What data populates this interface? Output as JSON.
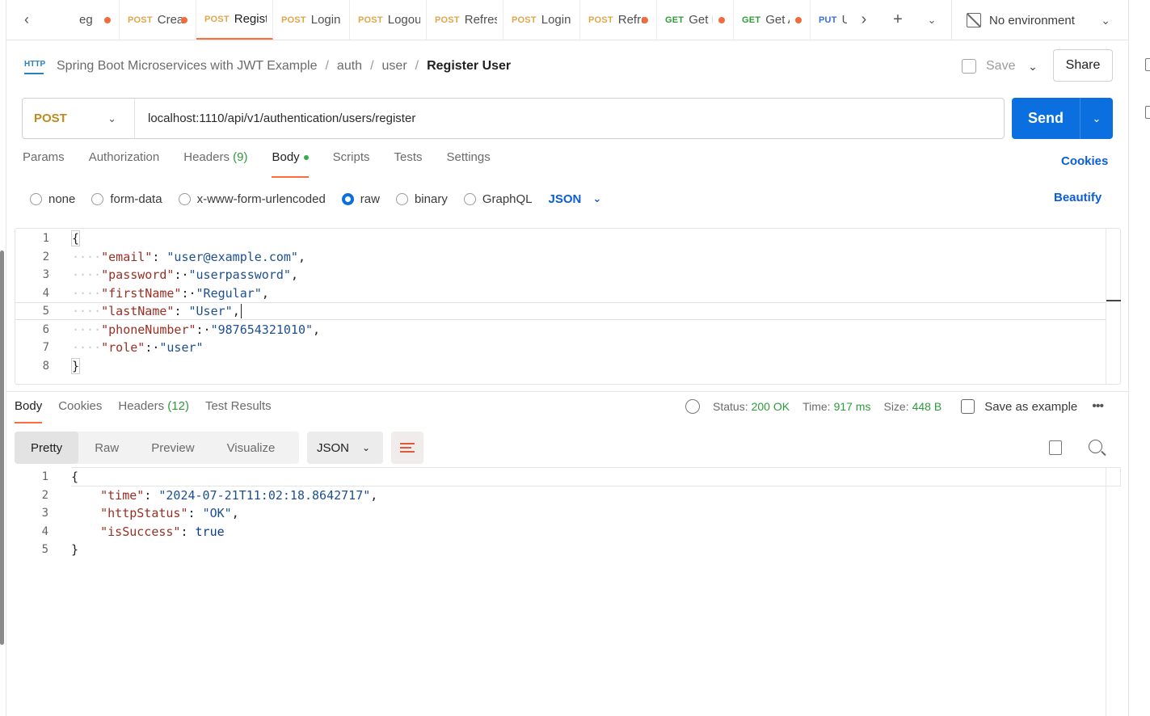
{
  "tabs": {
    "items": [
      {
        "method": "",
        "name": "eg",
        "dot": true,
        "active": false
      },
      {
        "method": "POST",
        "name": "Create",
        "dot": true,
        "active": false
      },
      {
        "method": "POST",
        "name": "Register",
        "dot": false,
        "active": true
      },
      {
        "method": "POST",
        "name": "Login",
        "dot": false,
        "active": false
      },
      {
        "method": "POST",
        "name": "Logout",
        "dot": false,
        "active": false
      },
      {
        "method": "POST",
        "name": "Refresh",
        "dot": false,
        "active": false
      },
      {
        "method": "POST",
        "name": "Login",
        "dot": false,
        "active": false
      },
      {
        "method": "POST",
        "name": "Refresh",
        "dot": true,
        "active": false
      },
      {
        "method": "GET",
        "name": "Get P",
        "dot": true,
        "active": false
      },
      {
        "method": "GET",
        "name": "Get A",
        "dot": true,
        "active": false
      },
      {
        "method": "PUT",
        "name": "Update",
        "dot": false,
        "active": false
      }
    ],
    "environment": "No environment"
  },
  "breadcrumb": {
    "collection": "Spring Boot Microservices with JWT Example",
    "folder1": "auth",
    "folder2": "user",
    "current": "Register User",
    "save_label": "Save",
    "share_label": "Share"
  },
  "request": {
    "method": "POST",
    "url": "localhost:1110/api/v1/authentication/users/register",
    "send_label": "Send",
    "tabs": {
      "params": "Params",
      "authorization": "Authorization",
      "headers": "Headers",
      "headers_count": "(9)",
      "body": "Body",
      "scripts": "Scripts",
      "tests": "Tests",
      "settings": "Settings"
    },
    "cookies_label": "Cookies",
    "body_types": [
      "none",
      "form-data",
      "x-www-form-urlencoded",
      "raw",
      "binary",
      "GraphQL"
    ],
    "selected_body_type": "raw",
    "format": "JSON",
    "beautify_label": "Beautify",
    "body_lines": [
      {
        "ln": "1",
        "indent": "",
        "key": "",
        "sep": "",
        "val": "",
        "text": "{"
      },
      {
        "ln": "2",
        "indent": "····",
        "key": "\"email\"",
        "sep": ": ",
        "val": "\"user@example.com\"",
        "text": ","
      },
      {
        "ln": "3",
        "indent": "····",
        "key": "\"password\"",
        "sep": ":·",
        "val": "\"userpassword\"",
        "text": ","
      },
      {
        "ln": "4",
        "indent": "····",
        "key": "\"firstName\"",
        "sep": ":·",
        "val": "\"Regular\"",
        "text": ","
      },
      {
        "ln": "5",
        "indent": "····",
        "key": "\"lastName\"",
        "sep": ": ",
        "val": "\"User\"",
        "text": ","
      },
      {
        "ln": "6",
        "indent": "····",
        "key": "\"phoneNumber\"",
        "sep": ":·",
        "val": "\"987654321010\"",
        "text": ","
      },
      {
        "ln": "7",
        "indent": "····",
        "key": "\"role\"",
        "sep": ":·",
        "val": "\"user\"",
        "text": ""
      },
      {
        "ln": "8",
        "indent": "",
        "key": "",
        "sep": "",
        "val": "",
        "text": "}"
      }
    ]
  },
  "response": {
    "tabs": {
      "body": "Body",
      "cookies": "Cookies",
      "headers": "Headers",
      "headers_count": "(12)",
      "test_results": "Test Results"
    },
    "status_label": "Status:",
    "status_value": "200 OK",
    "time_label": "Time:",
    "time_value": "917 ms",
    "size_label": "Size:",
    "size_value": "448 B",
    "save_example_label": "Save as example",
    "views": [
      "Pretty",
      "Raw",
      "Preview",
      "Visualize"
    ],
    "active_view": "Pretty",
    "format": "JSON",
    "body_lines": [
      {
        "ln": "1",
        "key": "",
        "sep": "",
        "val": "",
        "text": "{"
      },
      {
        "ln": "2",
        "key": "\"time\"",
        "sep": ": ",
        "val": "\"2024-07-21T11:02:18.8642717\"",
        "text": ","
      },
      {
        "ln": "3",
        "key": "\"httpStatus\"",
        "sep": ": ",
        "val": "\"OK\"",
        "text": ","
      },
      {
        "ln": "4",
        "key": "\"isSuccess\"",
        "sep": ": ",
        "val": "true",
        "text": ""
      },
      {
        "ln": "5",
        "key": "",
        "sep": "",
        "val": "",
        "text": "}"
      }
    ]
  },
  "colors": {
    "accent": "#ff6c37",
    "send": "#0b6fe0",
    "success": "#2f9a3b"
  }
}
